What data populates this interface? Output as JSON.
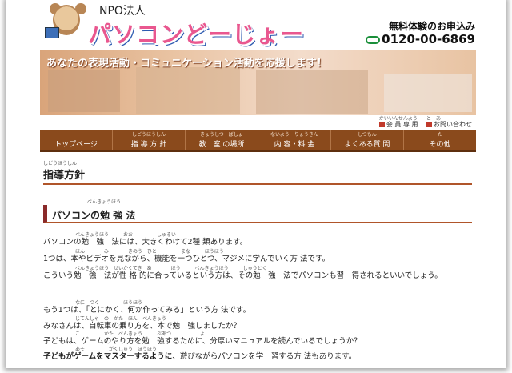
{
  "header": {
    "npo": "NPO法人",
    "brand": "パソコンどーじょー",
    "trial": "無料体験のお申込み",
    "tel": "0120-00-6869"
  },
  "banner": {
    "tagline": "あなたの表現活動・コミュニケーション活動を応援します！"
  },
  "sublinks": [
    {
      "ruby": "かいいんせんよう",
      "label": "会 員 専 用"
    },
    {
      "ruby": "と　あ",
      "label": "お問い合わせ"
    }
  ],
  "nav": [
    {
      "ruby": "",
      "label": "トップページ"
    },
    {
      "ruby": "しどうほうしん",
      "label": "指 導 方 針"
    },
    {
      "ruby": "きょうしつ　ばしょ",
      "label": "教　室 の場所"
    },
    {
      "ruby": "ないよう　りょうきん",
      "label": "内 容・料 金"
    },
    {
      "ruby": "しつもん",
      "label": "よくある質 問"
    },
    {
      "ruby": "た",
      "label": "その他"
    }
  ],
  "page": {
    "title_ruby": "しどうほうしん",
    "title": "指導方針",
    "section_ruby": "べんきょうほう",
    "section": "パソコンの勉 強 法"
  },
  "paragraphs": [
    {
      "ruby": "べんきょうほう　　　おお　　　　　しゅるい",
      "text": "パソコンの勉　強　法には、大きくわけて2種 類あります。"
    },
    {
      "ruby": "ほん　　　　み　　　　きのう　ひと　　　　　まな　　　ほうほう",
      "text": "1つは、本やビデオを見ながら、機能を一つひとつ、マジメに学んでいく方 法です。"
    },
    {
      "ruby": "べんきょうほう　せいかくてき　あ　　　　ほう　　　べんきょうほう　　　しゅうとく",
      "text": "こういう勉　強　法が性 格 的に合っているという方は、その勉　強　法でパソコンも習　得されるといいでしょう。"
    },
    {
      "ruby": "なに　つく　　　　　ほうほう",
      "text": "もう1つは、「とにかく、何か作ってみる」という方 法です。"
    },
    {
      "ruby": "じてんしゃ　の　かた　ほん　べんきょう",
      "text": "みなさんは、自転車の乗り方を、本で勉　強しましたか？"
    },
    {
      "ruby": "こ　　　　　かた　べんきょう　　　ぶあつ　　　　　　よ",
      "text": "子どもは、ゲームのやり方を勉　強するために、分厚いマニュアルを読んでいるでしょうか？"
    },
    {
      "ruby": "あそ　　　　　がくしゅう　ほうほう",
      "bold": "子どもがゲームをマスターするように",
      "text": "、遊びながらパソコンを学　習する方 法もあります。"
    }
  ]
}
